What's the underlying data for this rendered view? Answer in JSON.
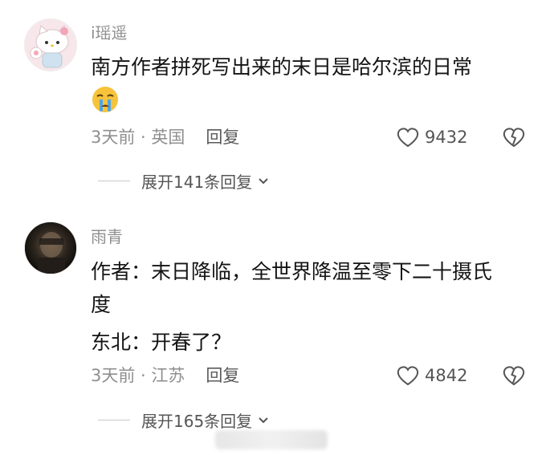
{
  "comments": [
    {
      "username": "i瑶遥",
      "content_lines": [
        "南方作者拼死写出来的末日是哈尔滨的日常"
      ],
      "emoji": "crying-emoji",
      "meta": "3天前 · 英国",
      "reply_label": "回复",
      "likes": "9432",
      "expand_label": "展开141条回复"
    },
    {
      "username": "雨青",
      "content_lines": [
        "作者：末日降临，全世界降温至零下二十摄氏",
        "度",
        "东北：开春了？"
      ],
      "meta": "3天前 · 江苏",
      "reply_label": "回复",
      "likes": "4842",
      "expand_label": "展开165条回复"
    }
  ],
  "colors": {
    "meta": "#8f8f8f",
    "text": "#141414",
    "icon": "#555555"
  }
}
